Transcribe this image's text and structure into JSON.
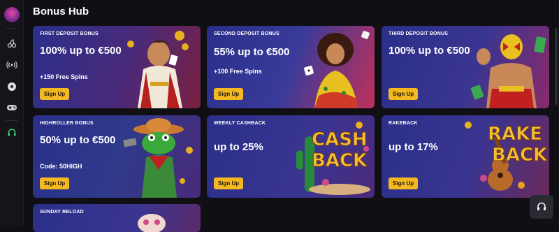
{
  "page": {
    "title": "Bonus Hub"
  },
  "cards": [
    {
      "label": "FIRST DEPOSIT BONUS",
      "amount": "100% up to €500",
      "sub": "+150 Free Spins",
      "button": "Sign Up"
    },
    {
      "label": "SECOND DEPOSIT BONUS",
      "amount": "55% up to €500",
      "sub": "+100 Free Spins",
      "button": "Sign Up"
    },
    {
      "label": "THIRD DEPOSIT BONUS",
      "amount": "100% up to €500",
      "sub": "",
      "button": "Sign Up"
    },
    {
      "label": "HIGHROLLER BONUS",
      "amount": "50% up to €500",
      "sub": "Code: 50HIGH",
      "button": "Sign Up"
    },
    {
      "label": "WEEKLY CASHBACK",
      "amount": "up to 25%",
      "sub": "",
      "button": "Sign Up",
      "art_text": [
        "CASH",
        "BACK"
      ]
    },
    {
      "label": "RAKEBACK",
      "amount": "up to 17%",
      "sub": "",
      "button": "Sign Up",
      "art_text": [
        "RAKE",
        "BACK"
      ]
    },
    {
      "label": "SUNDAY RELOAD",
      "amount": "",
      "sub": "",
      "button": ""
    }
  ],
  "sidebar": {
    "icons": [
      "logo-icon",
      "cherries-icon",
      "live-broadcast-icon",
      "soccer-ball-icon",
      "gamepad-icon",
      "headset-icon"
    ]
  },
  "colors": {
    "accent": "#f5b820",
    "background": "#0f0f14",
    "support_accent": "#3ddc84"
  }
}
